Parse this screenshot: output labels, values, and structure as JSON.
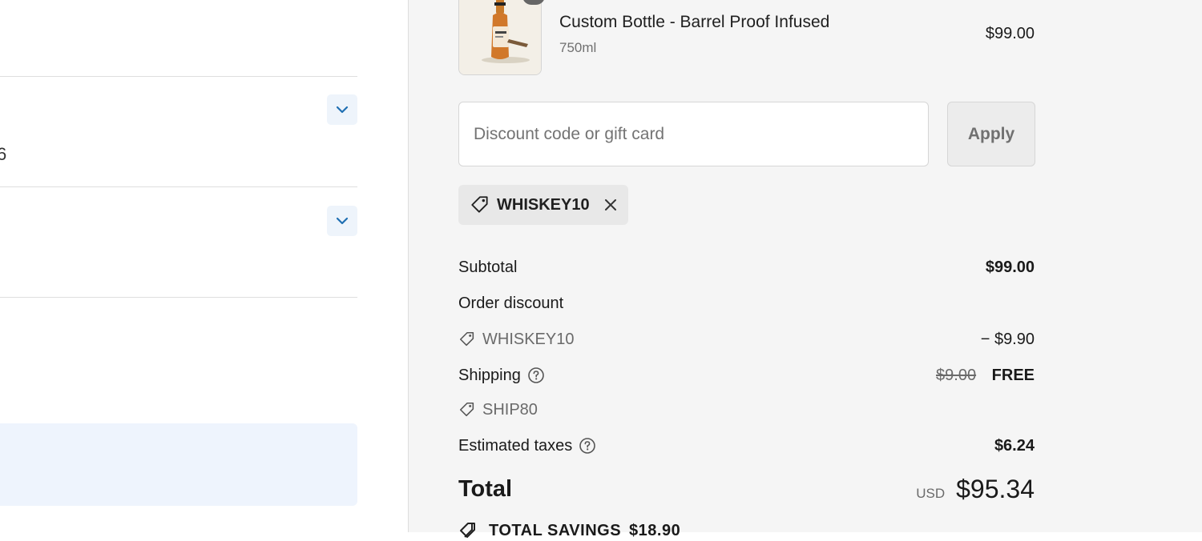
{
  "product": {
    "name": "Custom Bottle - Barrel Proof Infused",
    "variant": "750ml",
    "price": "$99.00",
    "thumbnail_icon": "whiskey-bottle-icon"
  },
  "discount": {
    "placeholder": "Discount code or gift card",
    "value": "",
    "apply_label": "Apply",
    "applied_code": "WHISKEY10"
  },
  "summary": {
    "subtotal_label": "Subtotal",
    "subtotal_value": "$99.00",
    "order_discount_label": "Order discount",
    "order_discount_code": "WHISKEY10",
    "order_discount_value": "− $9.90",
    "shipping_label": "Shipping",
    "shipping_original": "$9.00",
    "shipping_value": "FREE",
    "shipping_code": "SHIP80",
    "taxes_label": "Estimated taxes",
    "taxes_value": "$6.24",
    "total_label": "Total",
    "total_currency": "USD",
    "total_value": "$95.34",
    "savings_label": "TOTAL SAVINGS",
    "savings_value": "$18.90"
  },
  "left": {
    "stub_text": "6"
  },
  "colors": {
    "accent": "#1f6fb2",
    "sidebar_bg": "#f5f5f5",
    "notice_bg": "#eef4fd"
  }
}
